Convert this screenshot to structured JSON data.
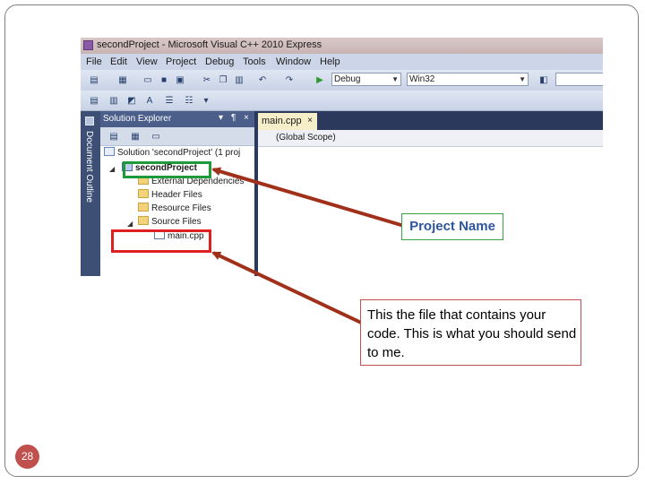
{
  "window": {
    "title": "secondProject - Microsoft Visual C++ 2010 Express"
  },
  "menu": [
    "File",
    "Edit",
    "View",
    "Project",
    "Debug",
    "Tools",
    "Window",
    "Help"
  ],
  "toolbar": {
    "config": "Debug",
    "platform": "Win32"
  },
  "doc_outline": {
    "label": "Document Outline"
  },
  "solution_explorer": {
    "title": "Solution Explorer",
    "pin": "¶",
    "close": "×",
    "tree": {
      "solution": "Solution 'secondProject' (1 proj",
      "project": "secondProject",
      "external": "External Dependencies",
      "headers": "Header Files",
      "resources": "Resource Files",
      "sources": "Source Files",
      "main": "main.cpp"
    }
  },
  "editor": {
    "tab": "main.cpp",
    "tab_close": "×",
    "scope": "(Global Scope)"
  },
  "callouts": {
    "project_name": "Project Name",
    "file_note": "This the file that contains your code. This is what you should send to me."
  },
  "slide": {
    "page_number": "28"
  },
  "colors": {
    "green": "#1f9a3a",
    "red": "#e02020",
    "arrow": "#a0301a",
    "accent": "#c0504d"
  }
}
